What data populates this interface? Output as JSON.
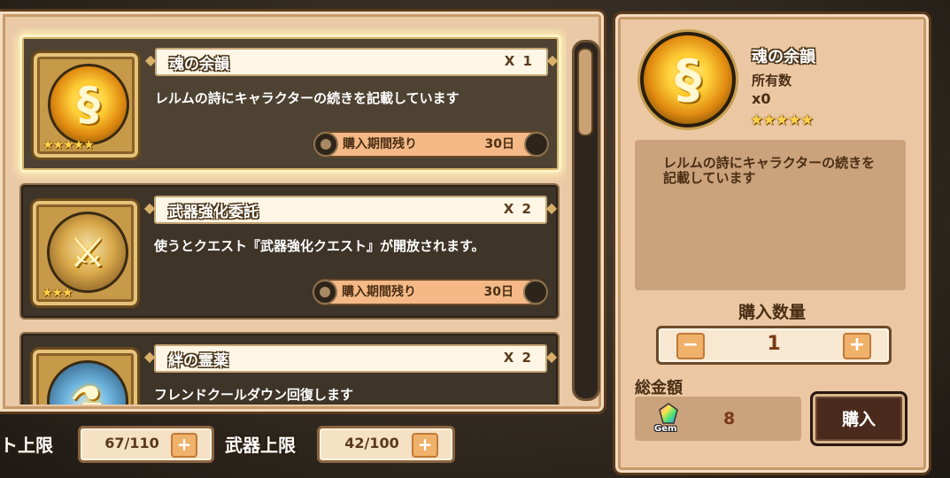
{
  "items": [
    {
      "name": "魂の余韻",
      "qty": "X 1",
      "description": "レルムの詩にキャラクターの続きを記載しています",
      "period_label": "購入期間残り",
      "period_days": "30日",
      "stars": "★★★★★",
      "icon": "soul-scroll-icon",
      "selected": true
    },
    {
      "name": "武器強化委託",
      "qty": "X 2",
      "description": "使うとクエスト『武器強化クエスト』が開放されます。",
      "period_label": "購入期間残り",
      "period_days": "30日",
      "stars": "★★★",
      "icon": "weapon-quest-icon",
      "selected": false
    },
    {
      "name": "絆の霊薬",
      "qty": "X 2",
      "description": "フレンドクールダウン回復します",
      "icon": "potion-icon",
      "selected": false
    }
  ],
  "status": {
    "unit_label": "ト上限",
    "unit_value": "67/110",
    "weapon_label": "武器上限",
    "weapon_value": "42/100"
  },
  "detail": {
    "name": "魂の余韻",
    "own_label": "所有数",
    "own_count": "x0",
    "stars": "★★★★★",
    "description": "レルムの詩にキャラクターの続きを記載しています",
    "qty_title": "購入数量",
    "qty_value": "1",
    "total_label": "総金額",
    "gem_label": "Gem",
    "total_value": "8",
    "buy_label": "購入"
  },
  "colors": {
    "panel": "#ebc8a3",
    "card": "#3e3428",
    "accent": "#f0b16a",
    "text_dark": "#4a2e14"
  }
}
